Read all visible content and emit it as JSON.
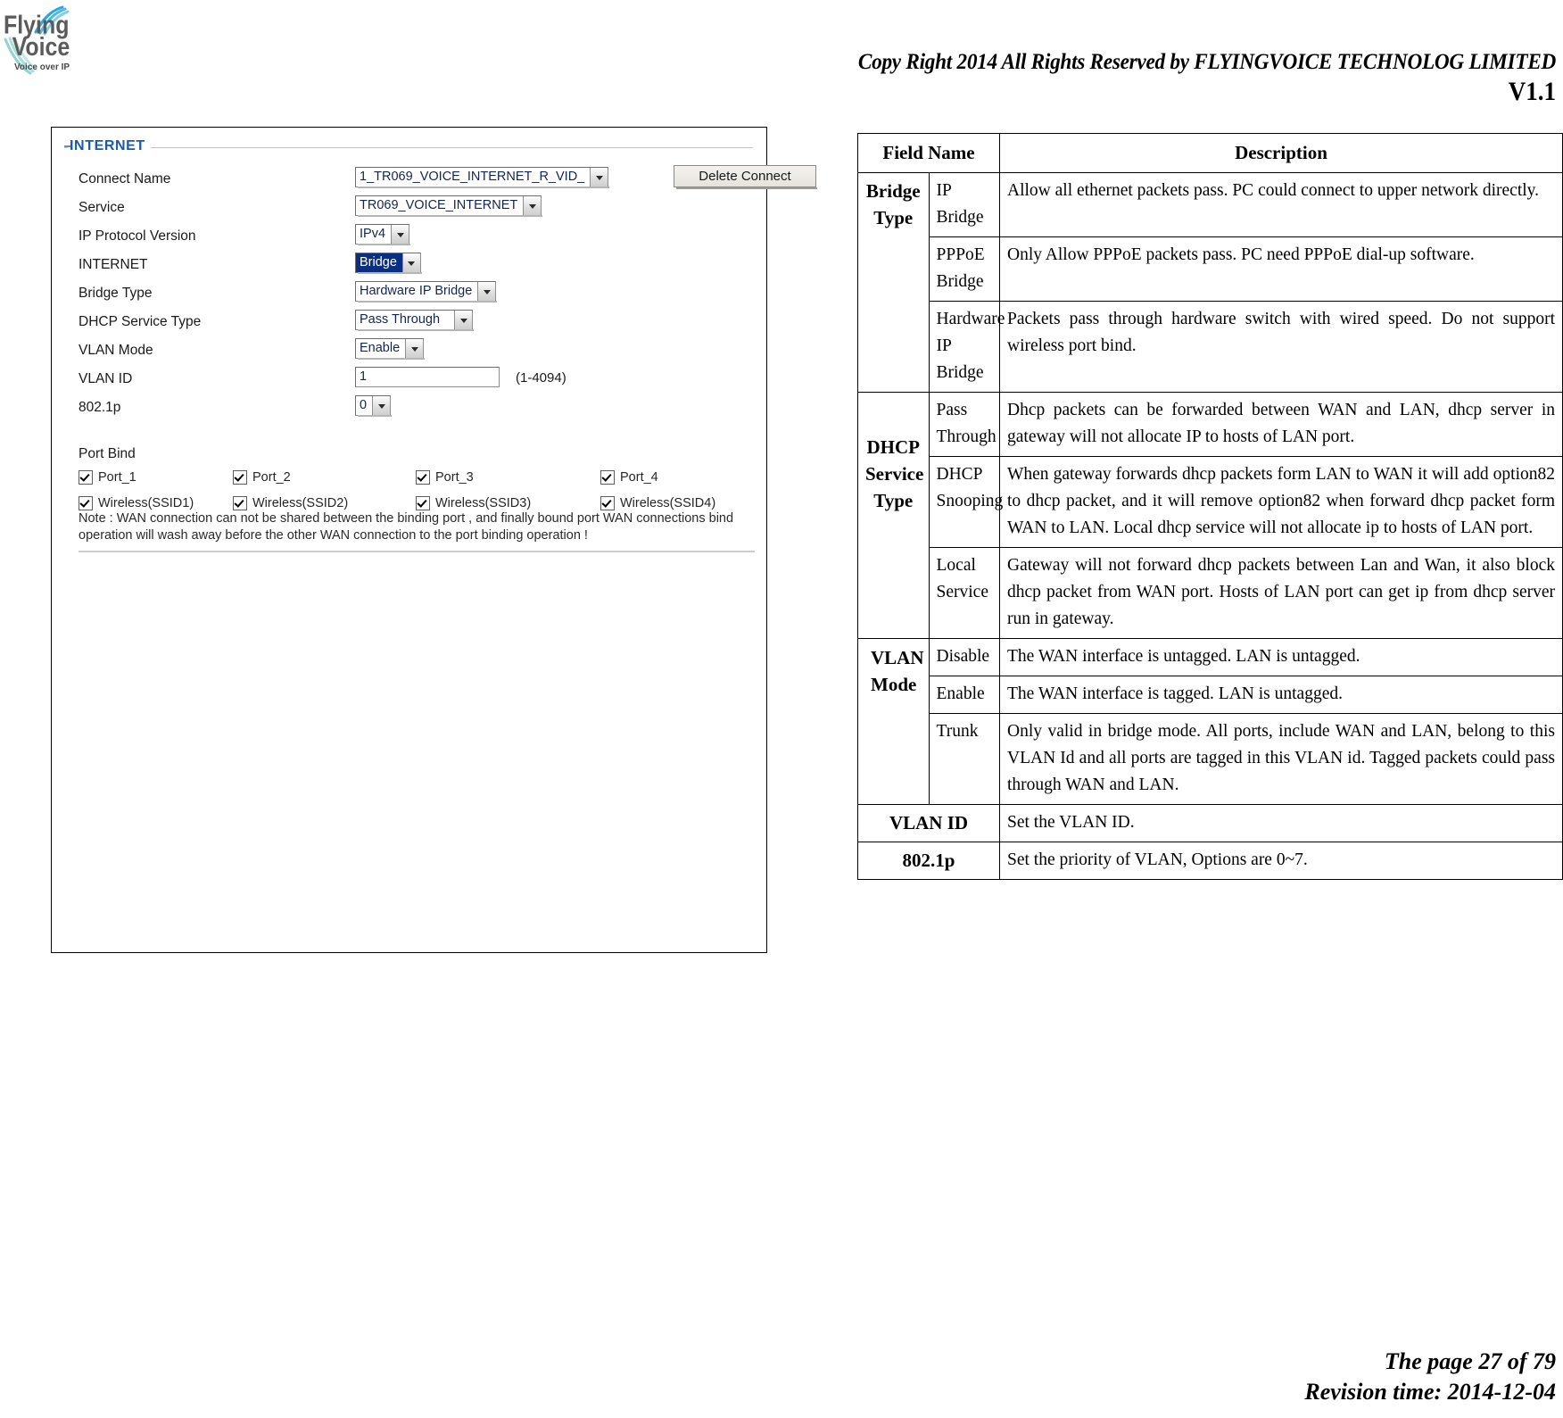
{
  "header": {
    "logo_alt": "Flying Voice",
    "logo_line1": "Flying",
    "logo_line2": "Voice",
    "logo_tagline": "Voice over IP",
    "copyright": "Copy Right 2014 All Rights Reserved by FLYINGVOICE TECHNOLOG LIMITED",
    "version": "V1.1"
  },
  "router_panel": {
    "legend": "INTERNET",
    "delete_button": "Delete Connect",
    "fields": [
      {
        "label": "Connect Name",
        "type": "select",
        "value": "1_TR069_VOICE_INTERNET_R_VID_",
        "highlighted": false
      },
      {
        "label": "Service",
        "type": "select",
        "value": "TR069_VOICE_INTERNET",
        "highlighted": false
      },
      {
        "label": "IP Protocol Version",
        "type": "select",
        "value": "IPv4",
        "highlighted": false
      },
      {
        "label": "INTERNET",
        "type": "select",
        "value": "Bridge",
        "highlighted": true
      },
      {
        "label": "Bridge Type",
        "type": "select",
        "value": "Hardware IP Bridge",
        "highlighted": false
      },
      {
        "label": "DHCP Service Type",
        "type": "select",
        "value": "Pass Through",
        "highlighted": false
      },
      {
        "label": "VLAN Mode",
        "type": "select",
        "value": "Enable",
        "highlighted": false
      },
      {
        "label": "VLAN ID",
        "type": "text",
        "value": "1",
        "hint": "(1-4094)"
      },
      {
        "label": "802.1p",
        "type": "select",
        "value": "0",
        "highlighted": false
      }
    ],
    "port_bind_label": "Port Bind",
    "port_bind_row1": [
      {
        "label": "Port_1",
        "checked": true
      },
      {
        "label": "Port_2",
        "checked": true
      },
      {
        "label": "Port_3",
        "checked": true
      },
      {
        "label": "Port_4",
        "checked": true
      }
    ],
    "port_bind_row2": [
      {
        "label": "Wireless(SSID1)",
        "checked": true
      },
      {
        "label": "Wireless(SSID2)",
        "checked": true
      },
      {
        "label": "Wireless(SSID3)",
        "checked": true
      },
      {
        "label": "Wireless(SSID4)",
        "checked": true
      }
    ],
    "note": "Note : WAN connection can not be shared between the binding port , and finally bound port WAN connections bind operation will wash away before the other WAN connection to the port binding operation !"
  },
  "reference_table": {
    "headers": {
      "field_name": "Field Name",
      "description": "Description"
    },
    "groups": [
      {
        "field": "Bridge Type",
        "rows": [
          {
            "option": "IP Bridge",
            "description": "Allow all ethernet packets pass. PC could connect to upper network directly."
          },
          {
            "option": "PPPoE Bridge",
            "description": "Only Allow PPPoE packets pass. PC need PPPoE dial-up software."
          },
          {
            "option": "Hardware IP Bridge",
            "description": "Packets pass through hardware switch with wired speed. Do not support wireless port bind."
          }
        ]
      },
      {
        "field": "DHCP Service Type",
        "rows": [
          {
            "option": "Pass Through",
            "description": "Dhcp packets can be forwarded between WAN and LAN, dhcp server in gateway will not allocate IP to hosts of LAN port."
          },
          {
            "option": "DHCP Snooping",
            "description": "When gateway forwards dhcp packets form LAN to WAN it will add option82 to dhcp packet, and it will remove option82 when forward dhcp packet form WAN to LAN. Local dhcp service will not allocate ip to hosts of LAN port."
          },
          {
            "option": "Local Service",
            "description": "Gateway will not forward dhcp packets between Lan and Wan, it also block dhcp packet from WAN port. Hosts of LAN port can get ip from dhcp server run in gateway."
          }
        ]
      },
      {
        "field": "VLAN Mode",
        "rows": [
          {
            "option": "Disable",
            "description": "The WAN interface is untagged. LAN is untagged."
          },
          {
            "option": "Enable",
            "description": "The WAN interface is tagged. LAN is untagged."
          },
          {
            "option": "Trunk",
            "description": "Only valid in bridge mode. All ports, include WAN and LAN, belong to this VLAN Id and all ports are tagged in this VLAN id. Tagged packets could pass through WAN and LAN."
          }
        ]
      }
    ],
    "simple_rows": [
      {
        "field": "VLAN ID",
        "description": "Set the VLAN ID."
      },
      {
        "field": "802.1p",
        "description": "Set the priority of VLAN, Options are 0~7."
      }
    ]
  },
  "footer": {
    "page": "The page 27 of 79",
    "revision": "Revision time: 2014-12-04"
  }
}
